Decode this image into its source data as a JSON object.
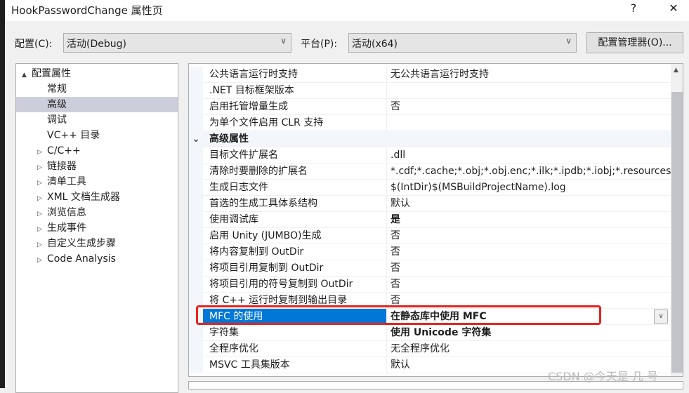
{
  "window": {
    "title": "HookPasswordChange 属性页",
    "help": "?",
    "close": "✕"
  },
  "config": {
    "label": "配置(C):",
    "value": "活动(Debug)",
    "platform_label": "平台(P):",
    "platform_value": "活动(x64)",
    "manager_button": "配置管理器(O)..."
  },
  "tree": [
    {
      "label": "配置属性",
      "expander": "▲",
      "indent": 0
    },
    {
      "label": "常规",
      "expander": "",
      "indent": 1
    },
    {
      "label": "高级",
      "expander": "",
      "indent": 1,
      "selected": true
    },
    {
      "label": "调试",
      "expander": "",
      "indent": 1
    },
    {
      "label": "VC++ 目录",
      "expander": "",
      "indent": 1
    },
    {
      "label": "C/C++",
      "expander": "▷",
      "indent": 1
    },
    {
      "label": "链接器",
      "expander": "▷",
      "indent": 1
    },
    {
      "label": "清单工具",
      "expander": "▷",
      "indent": 1
    },
    {
      "label": "XML 文档生成器",
      "expander": "▷",
      "indent": 1
    },
    {
      "label": "浏览信息",
      "expander": "▷",
      "indent": 1
    },
    {
      "label": "生成事件",
      "expander": "▷",
      "indent": 1
    },
    {
      "label": "自定义生成步骤",
      "expander": "▷",
      "indent": 1
    },
    {
      "label": "Code Analysis",
      "expander": "▷",
      "indent": 1
    }
  ],
  "grid": [
    {
      "k": "公共语言运行时支持",
      "v": "无公共语言运行时支持"
    },
    {
      "k": ".NET 目标框架版本",
      "v": ""
    },
    {
      "k": "启用托管增量生成",
      "v": "否"
    },
    {
      "k": "为单个文件启用 CLR 支持",
      "v": ""
    },
    {
      "k": "高级属性",
      "v": "",
      "section": true,
      "expander": "⌄"
    },
    {
      "k": "目标文件扩展名",
      "v": ".dll"
    },
    {
      "k": "清除时要删除的扩展名",
      "v": "*.cdf;*.cache;*.obj;*.obj.enc;*.ilk;*.ipdb;*.iobj;*.resources;"
    },
    {
      "k": "生成日志文件",
      "v": "$(IntDir)$(MSBuildProjectName).log"
    },
    {
      "k": "首选的生成工具体系结构",
      "v": "默认"
    },
    {
      "k": "使用调试库",
      "v": "是",
      "bold": true
    },
    {
      "k": "启用 Unity (JUMBO)生成",
      "v": "否"
    },
    {
      "k": "将内容复制到 OutDir",
      "v": "否"
    },
    {
      "k": "将项目引用复制到 OutDir",
      "v": "否"
    },
    {
      "k": "将项目引用的符号复制到 OutDir",
      "v": "否"
    },
    {
      "k": "将 C++ 运行时复制到输出目录",
      "v": "否"
    },
    {
      "k": "MFC 的使用",
      "v": "在静态库中使用 MFC",
      "bold": true,
      "selected": true
    },
    {
      "k": "字符集",
      "v": "使用 Unicode 字符集",
      "bold": true
    },
    {
      "k": "全程序优化",
      "v": "无全程序优化"
    },
    {
      "k": "MSVC 工具集版本",
      "v": "默认"
    }
  ],
  "watermark": "CSDN @今天是 几 号"
}
